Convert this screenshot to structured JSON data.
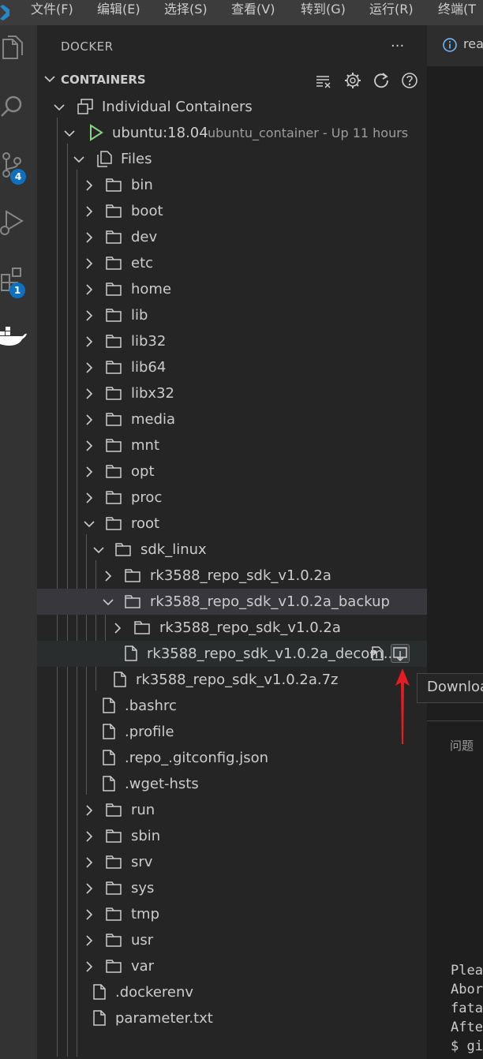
{
  "menubar": {
    "items": [
      "文件(F)",
      "编辑(E)",
      "选择(S)",
      "查看(V)",
      "转到(G)",
      "运行(R)",
      "终端(T"
    ]
  },
  "activity_bar": {
    "icons": [
      "explorer-icon",
      "search-icon",
      "source-control-icon",
      "run-debug-icon",
      "extensions-icon",
      "docker-icon"
    ],
    "source_control_badge": "4",
    "extensions_badge": "1"
  },
  "sidebar": {
    "title": "DOCKER",
    "section": "CONTAINERS",
    "group": "Individual Containers",
    "container": {
      "name": "ubuntu:18.04",
      "description": "ubuntu_container - Up 11 hours"
    },
    "files_label": "Files",
    "tree": [
      {
        "label": "bin",
        "type": "folder",
        "expanded": false
      },
      {
        "label": "boot",
        "type": "folder",
        "expanded": false
      },
      {
        "label": "dev",
        "type": "folder",
        "expanded": false
      },
      {
        "label": "etc",
        "type": "folder",
        "expanded": false
      },
      {
        "label": "home",
        "type": "folder",
        "expanded": false
      },
      {
        "label": "lib",
        "type": "folder",
        "expanded": false
      },
      {
        "label": "lib32",
        "type": "folder",
        "expanded": false
      },
      {
        "label": "lib64",
        "type": "folder",
        "expanded": false
      },
      {
        "label": "libx32",
        "type": "folder",
        "expanded": false
      },
      {
        "label": "media",
        "type": "folder",
        "expanded": false
      },
      {
        "label": "mnt",
        "type": "folder",
        "expanded": false
      },
      {
        "label": "opt",
        "type": "folder",
        "expanded": false
      },
      {
        "label": "proc",
        "type": "folder",
        "expanded": false
      },
      {
        "label": "root",
        "type": "folder",
        "expanded": true
      },
      {
        "label": "sdk_linux",
        "type": "folder",
        "expanded": true
      },
      {
        "label": "rk3588_repo_sdk_v1.0.2a",
        "type": "folder",
        "expanded": false
      },
      {
        "label": "rk3588_repo_sdk_v1.0.2a_backup",
        "type": "folder",
        "expanded": true
      },
      {
        "label": "rk3588_repo_sdk_v1.0.2a",
        "type": "folder",
        "expanded": false
      },
      {
        "label": "rk3588_repo_sdk_v1.0.2a_decom...",
        "type": "file"
      },
      {
        "label": "rk3588_repo_sdk_v1.0.2a.7z",
        "type": "file"
      },
      {
        "label": ".bashrc",
        "type": "file"
      },
      {
        "label": ".profile",
        "type": "file"
      },
      {
        "label": ".repo_.gitconfig.json",
        "type": "file"
      },
      {
        "label": ".wget-hsts",
        "type": "file"
      },
      {
        "label": "run",
        "type": "folder",
        "expanded": false
      },
      {
        "label": "sbin",
        "type": "folder",
        "expanded": false
      },
      {
        "label": "srv",
        "type": "folder",
        "expanded": false
      },
      {
        "label": "sys",
        "type": "folder",
        "expanded": false
      },
      {
        "label": "tmp",
        "type": "folder",
        "expanded": false
      },
      {
        "label": "usr",
        "type": "folder",
        "expanded": false
      },
      {
        "label": "var",
        "type": "folder",
        "expanded": false
      },
      {
        "label": ".dockerenv",
        "type": "file"
      },
      {
        "label": "parameter.txt",
        "type": "file"
      }
    ]
  },
  "editor": {
    "tab_label": "rea"
  },
  "tooltip": {
    "text": "Download"
  },
  "panel": {
    "tab_label": "问题",
    "terminal_lines": [
      "Plea",
      "Abor",
      "fata",
      "Afte",
      "$ gi"
    ]
  },
  "colors": {
    "accent_badge": "#0e70c0",
    "annotation_arrow": "#e51c23",
    "running_play": "#89d185"
  }
}
